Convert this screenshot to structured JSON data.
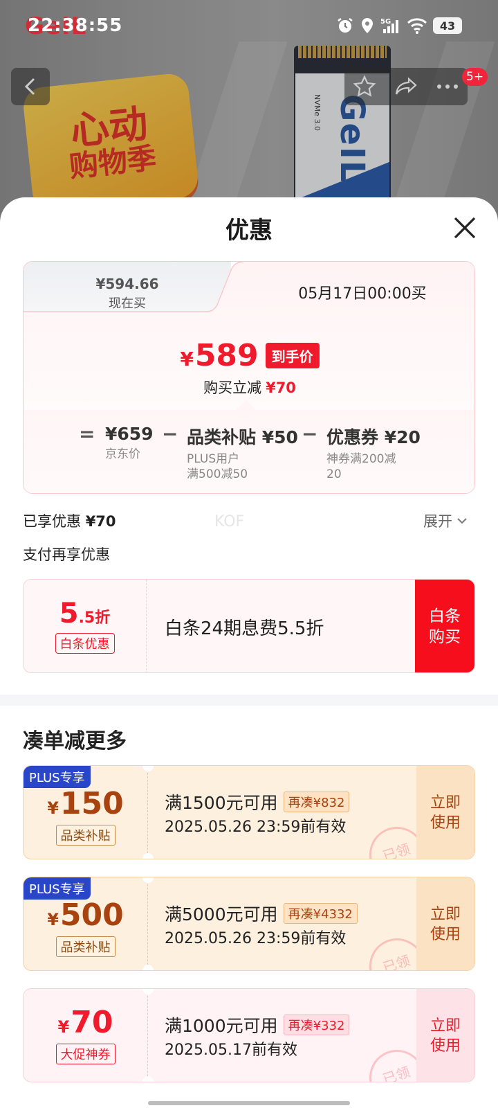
{
  "status_bar": {
    "time": "22:38:55",
    "battery": "43"
  },
  "banner": {
    "brand_logo": "GeIL",
    "promo_line1": "心动",
    "promo_line2": "购物季",
    "ssd_brand": "GeIL",
    "ssd_model": "NVMe 3.0",
    "message_badge": "5+"
  },
  "sheet": {
    "title": "优惠",
    "tab_now_price": "¥594.66",
    "tab_now_label": "现在买",
    "tab_future_label": "05月17日00:00买",
    "final_yen": "¥",
    "final_price": "589",
    "final_tag": "到手价",
    "reduce_label": "购买立减",
    "reduce_amount": "¥70",
    "calc": {
      "eq": "=",
      "jd_price": "¥659",
      "jd_label": "京东价",
      "minus": "−",
      "subsidy": "品类补贴 ¥50",
      "subsidy_sub1": "PLUS用户",
      "subsidy_sub2": "满500减50",
      "coupon": "优惠券 ¥20",
      "coupon_sub1": "神券满200减",
      "coupon_sub2": "20"
    },
    "enjoyed_label": "已享优惠",
    "enjoyed_amount": "¥70",
    "watermark": "KOF",
    "expand_label": "展开",
    "pay_title": "支付再享优惠",
    "baitiao": {
      "discount": "5",
      "discount_suffix": ".5折",
      "chip": "白条优惠",
      "text": "白条24期息费5.5折",
      "buy_line1": "白条",
      "buy_line2": "购买"
    },
    "section_title": "凑单减更多",
    "coupons": [
      {
        "plus_tag": "PLUS专享",
        "yen": "¥",
        "amount": "150",
        "chip": "品类补贴",
        "condition": "满1500元可用",
        "more": "再凑¥832",
        "valid": "2025.05.26 23:59前有效",
        "use_line1": "立即",
        "use_line2": "使用",
        "stamp": "已领"
      },
      {
        "plus_tag": "PLUS专享",
        "yen": "¥",
        "amount": "500",
        "chip": "品类补贴",
        "condition": "满5000元可用",
        "more": "再凑¥4332",
        "valid": "2025.05.26 23:59前有效",
        "use_line1": "立即",
        "use_line2": "使用",
        "stamp": "已领"
      },
      {
        "yen": "¥",
        "amount": "70",
        "chip": "大促神券",
        "condition": "满1000元可用",
        "more": "再凑¥332",
        "valid": "2025.05.17前有效",
        "use_line1": "立即",
        "use_line2": "使用",
        "stamp": "已领"
      }
    ]
  },
  "colors": {
    "accent_red": "#ef1a2b",
    "plus_blue": "#2a46c8",
    "gold_text": "#a8420f"
  }
}
